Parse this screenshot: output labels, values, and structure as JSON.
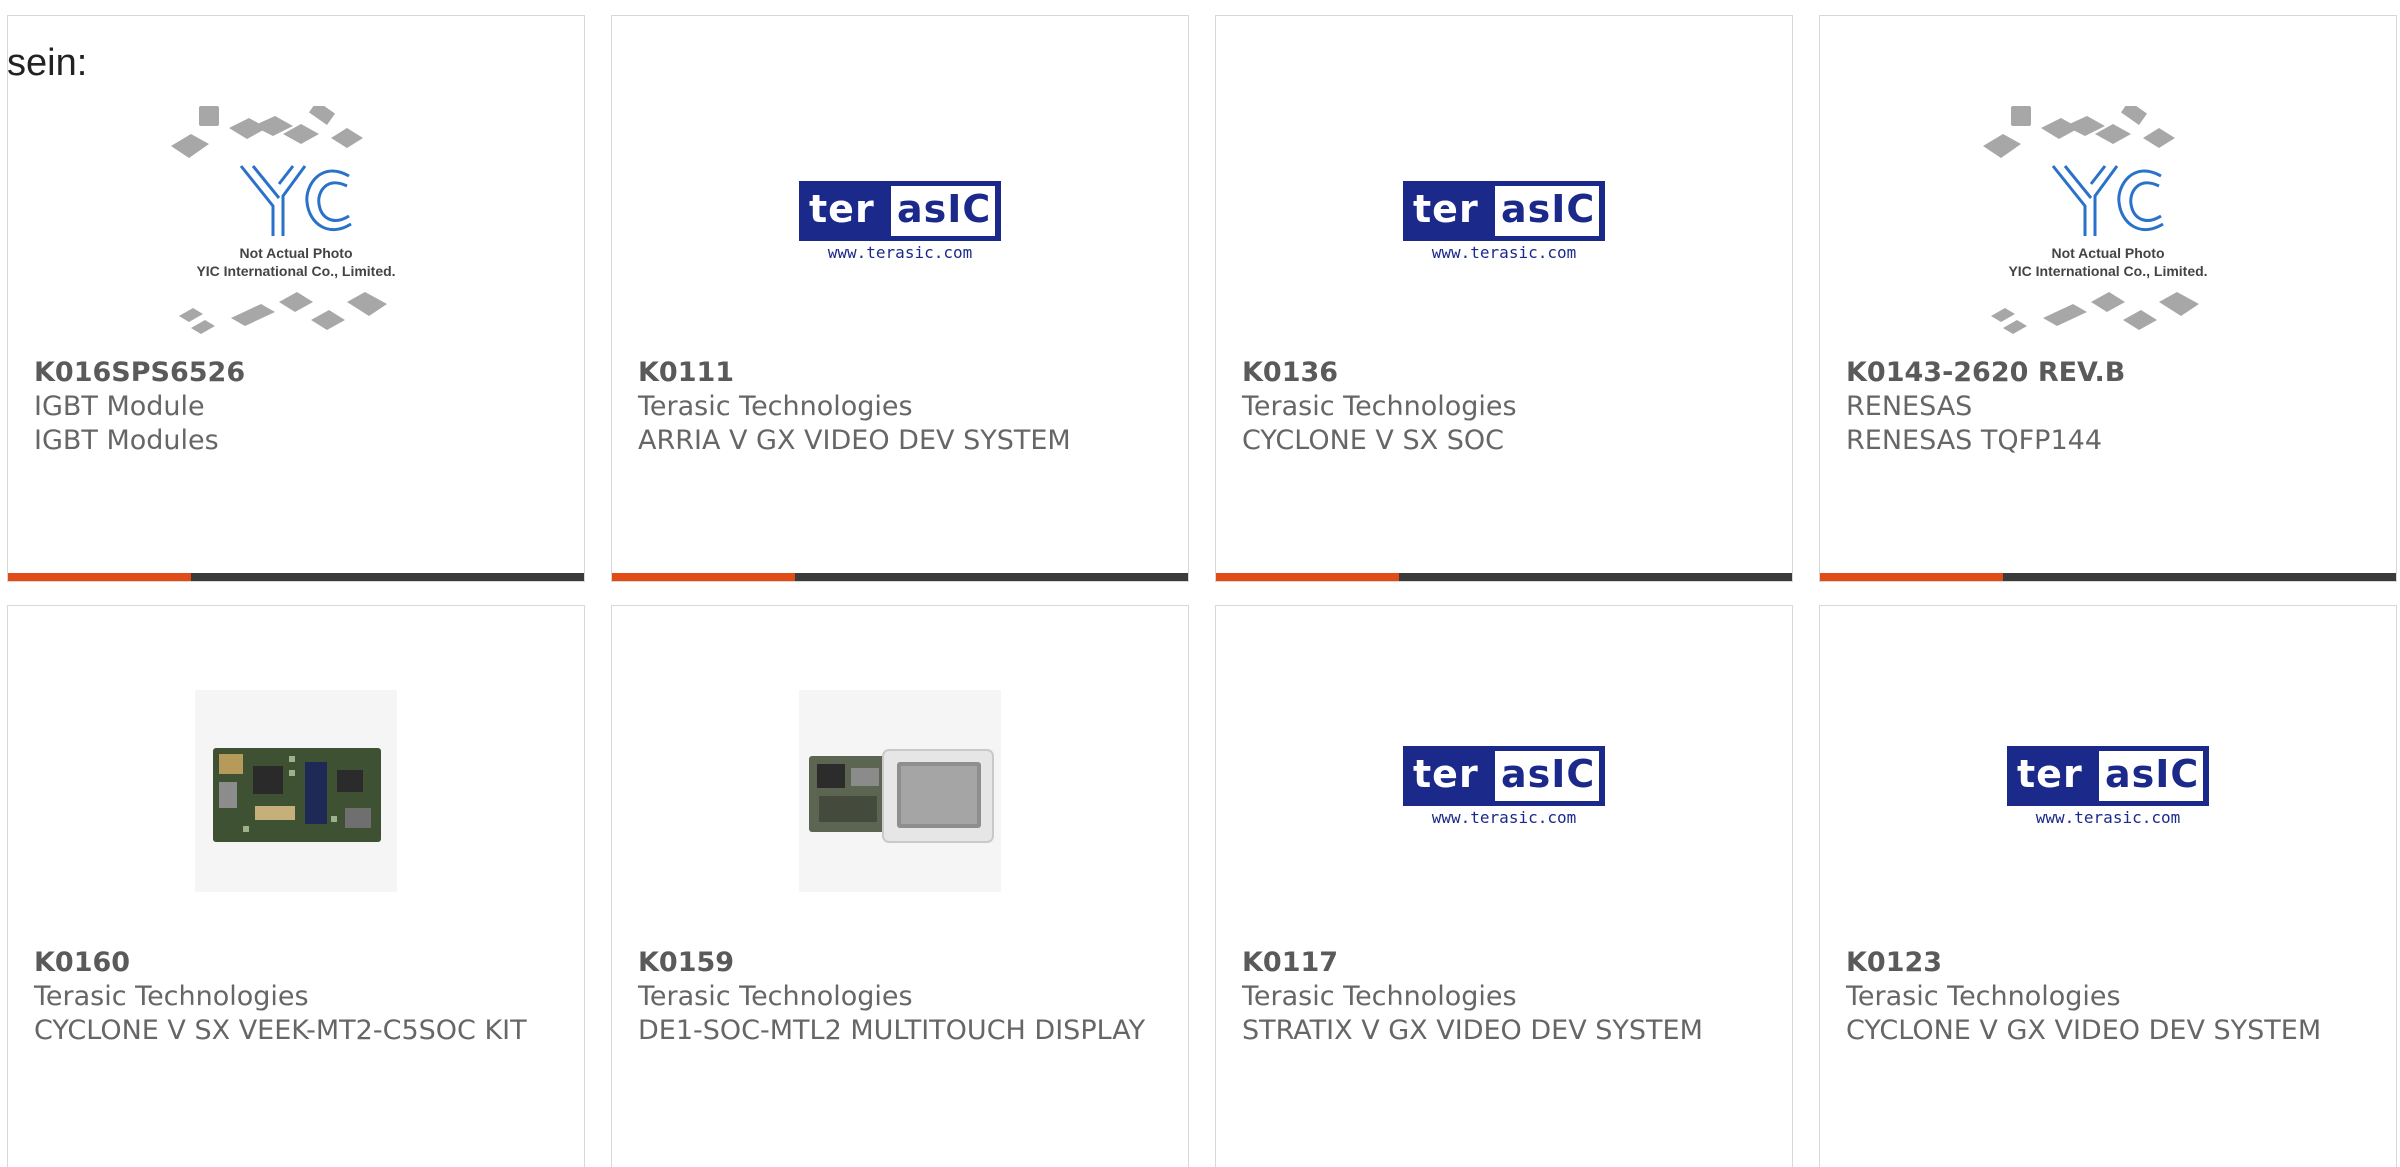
{
  "intro_text": "sein:",
  "colors": {
    "accent": "#e14b16",
    "stripe": "#3a3a3a",
    "terasic_blue": "#1b2a8a"
  },
  "logos": {
    "terasic_word_left": "ter",
    "terasic_word_right": "asIC",
    "terasic_url": "www.terasic.com",
    "yic_line1": "Not Actual Photo",
    "yic_line2": "YIC International Co., Limited."
  },
  "products": [
    {
      "part": "K016SPS6526",
      "maker": "IGBT Module",
      "desc": "IGBT Modules",
      "image": "yic-placeholder"
    },
    {
      "part": "K0111",
      "maker": "Terasic Technologies",
      "desc": "ARRIA V GX VIDEO DEV SYSTEM",
      "image": "terasic-logo"
    },
    {
      "part": "K0136",
      "maker": "Terasic Technologies",
      "desc": "CYCLONE V SX SOC",
      "image": "terasic-logo"
    },
    {
      "part": "K0143-2620 REV.B",
      "maker": "RENESAS",
      "desc": "RENESAS TQFP144",
      "image": "yic-placeholder"
    },
    {
      "part": "K0160",
      "maker": "Terasic Technologies",
      "desc": "CYCLONE V SX VEEK-MT2-C5SOC KIT",
      "image": "board-photo"
    },
    {
      "part": "K0159",
      "maker": "Terasic Technologies",
      "desc": "DE1-SOC-MTL2 MULTITOUCH DISPLAY",
      "image": "touch-display-photo"
    },
    {
      "part": "K0117",
      "maker": "Terasic Technologies",
      "desc": "STRATIX V GX VIDEO DEV SYSTEM",
      "image": "terasic-logo"
    },
    {
      "part": "K0123",
      "maker": "Terasic Technologies",
      "desc": "CYCLONE V GX VIDEO DEV SYSTEM",
      "image": "terasic-logo"
    }
  ]
}
